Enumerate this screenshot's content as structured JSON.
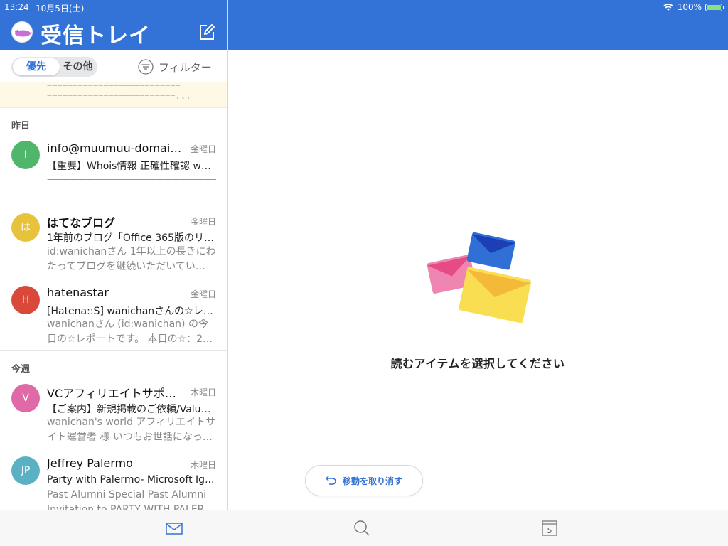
{
  "status": {
    "time": "13:24",
    "date": "10月5日(土)",
    "battery": "100%"
  },
  "header": {
    "title": "受信トレイ",
    "compose_icon": "compose-icon"
  },
  "tabs": {
    "focused": "優先",
    "other": "その他",
    "filter": "フィルター"
  },
  "preview_strip": {
    "line1": "==========================",
    "line2": "=========================..."
  },
  "sections": {
    "yesterday": "昨日",
    "this_week": "今週"
  },
  "mails": [
    {
      "initial": "I",
      "color": "#4fb66b",
      "sender": "info@muumuu-domain....",
      "day": "金曜日",
      "subject": "【重要】Whois情報 正確性確認 wa...",
      "preview": "————————————————————————————————…"
    },
    {
      "initial": "は",
      "color": "#e7c33b",
      "sender": "はてなブログ",
      "day": "金曜日",
      "subject": "1年前のブログ「Office 365版のリ…",
      "preview": "id:wanichanさん 1年以上の長きにわたってブログを継続いただいてい…"
    },
    {
      "initial": "H",
      "color": "#d9493a",
      "sender": "hatenastar",
      "day": "金曜日",
      "subject": "[Hatena::S] wanichanさんの☆レ…",
      "preview": "wanichanさん (id:wanichan) の今日の☆レポートです。 本日の☆：2…"
    },
    {
      "initial": "V",
      "color": "#e06aa8",
      "sender": "VCアフィリエイトサポート",
      "day": "木曜日",
      "subject": "【ご案内】新規掲載のご依頼/Value...",
      "preview": "wanichan's world アフィリエイトサイト運営者 様 いつもお世話になっ…"
    },
    {
      "initial": "JP",
      "color": "#5bb1c4",
      "sender": "Jeffrey Palermo",
      "day": "木曜日",
      "subject": "Party with Palermo- Microsoft Ig...",
      "preview": "Past Alumni Special Past Alumni Invitation to PARTY WITH PALER…"
    }
  ],
  "reading_pane": {
    "empty_message": "読むアイテムを選択してください",
    "undo_label": "移動を取り消す"
  },
  "tabbar": {
    "mail_icon": "mail-icon",
    "search_icon": "search-icon",
    "calendar_icon": "calendar-icon",
    "calendar_day": "5"
  },
  "colors": {
    "accent": "#3372d6"
  }
}
